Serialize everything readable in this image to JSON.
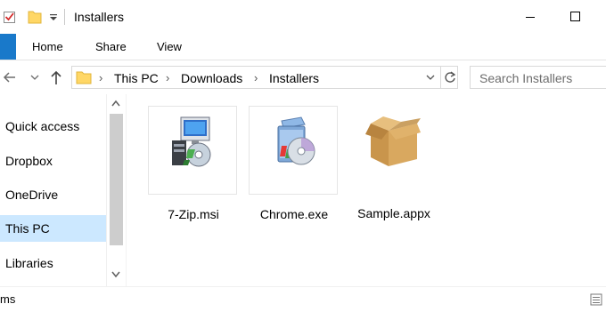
{
  "window": {
    "title": "Installers"
  },
  "ribbon": {
    "tabs": [
      {
        "label": "Home"
      },
      {
        "label": "Share"
      },
      {
        "label": "View"
      }
    ]
  },
  "address": {
    "breadcrumbs": [
      {
        "label": "This PC"
      },
      {
        "label": "Downloads"
      },
      {
        "label": "Installers"
      }
    ],
    "separator": "›"
  },
  "search": {
    "placeholder": "Search Installers"
  },
  "sidebar": {
    "items": [
      {
        "label": "Quick access",
        "selected": false
      },
      {
        "label": "Dropbox",
        "selected": false
      },
      {
        "label": "OneDrive",
        "selected": false
      },
      {
        "label": "This PC",
        "selected": true
      },
      {
        "label": "Libraries",
        "selected": false
      }
    ]
  },
  "files": [
    {
      "name": "7-Zip.msi",
      "icon": "msi-installer-icon"
    },
    {
      "name": "Chrome.exe",
      "icon": "exe-installer-icon"
    },
    {
      "name": "Sample.appx",
      "icon": "appx-package-icon"
    }
  ],
  "status": {
    "text": "ms"
  },
  "colors": {
    "accent": "#1979ca",
    "selection": "#cce8ff",
    "folder": "#ffd766"
  }
}
